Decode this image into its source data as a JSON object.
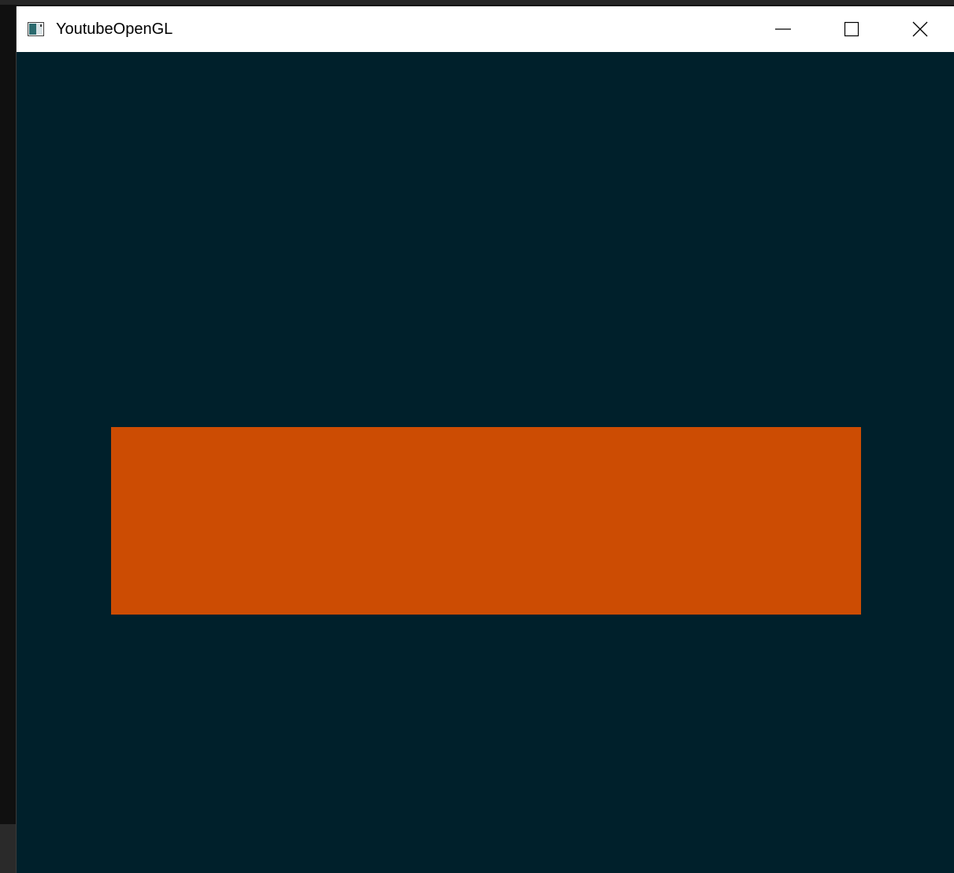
{
  "window": {
    "title": "YoutubeOpenGL",
    "app_icon": "opengl-app-icon",
    "controls": {
      "minimize_icon": "minimize-icon",
      "maximize_icon": "maximize-icon",
      "close_icon": "close-icon"
    }
  },
  "scene": {
    "clear_color": "#00202b",
    "shape": "rectangle",
    "shape_color": "#cc4c03"
  }
}
